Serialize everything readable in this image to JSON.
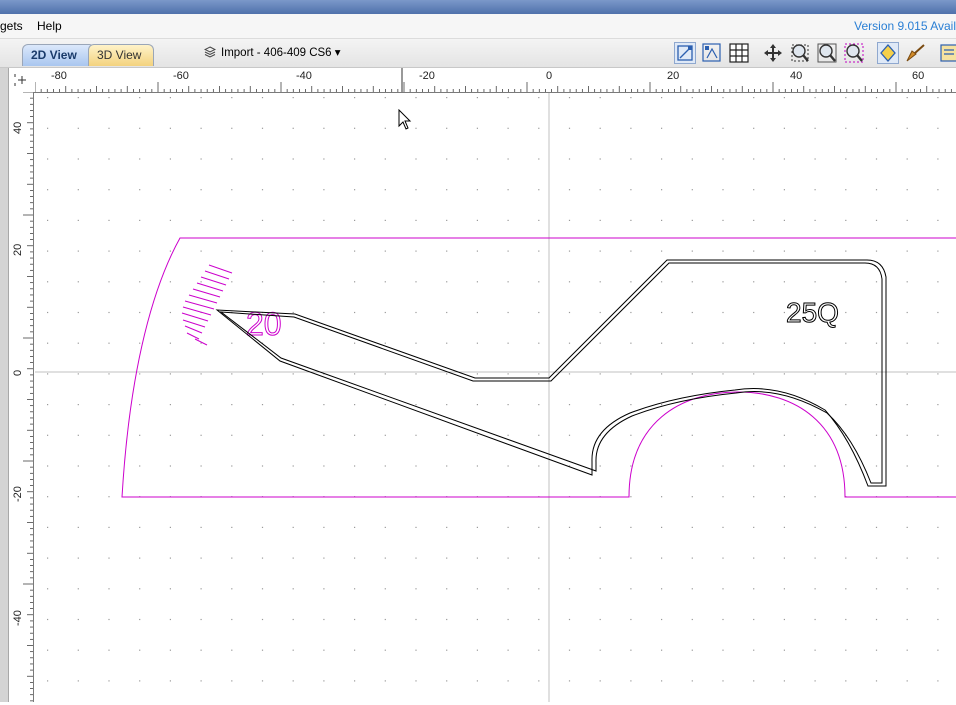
{
  "menu": {
    "items": [
      "gets",
      "Help"
    ],
    "version": "Version 9.015 Avail"
  },
  "tabs": {
    "view2d": "2D View",
    "view3d": "3D View"
  },
  "layer": {
    "label": "Import - 406-409 CS6",
    "arrow": "▾"
  },
  "toolbar_icons": [
    "select-box-icon",
    "node-edit-icon",
    "grid-icon",
    "pan-icon",
    "zoom-box-icon",
    "zoom-extents-icon",
    "zoom-selection-icon",
    "toolpath-preview-icon",
    "brush-tool-icon",
    "layer-menu-icon"
  ],
  "rulers": {
    "horizontal_labels": [
      "-80",
      "-60",
      "-40",
      "-20",
      "0",
      "20",
      "40",
      "60"
    ],
    "vertical_labels": [
      "40",
      "20",
      "0",
      "-20",
      "-40"
    ]
  },
  "canvas_text": {
    "magenta_text": "20",
    "part_text": "25Q"
  },
  "colors": {
    "outline": "#000000",
    "construction": "#cc00cc",
    "grid_dot": "#9a9a9a",
    "axis": "#b8b8b8",
    "accent": "#2a7fd4"
  }
}
